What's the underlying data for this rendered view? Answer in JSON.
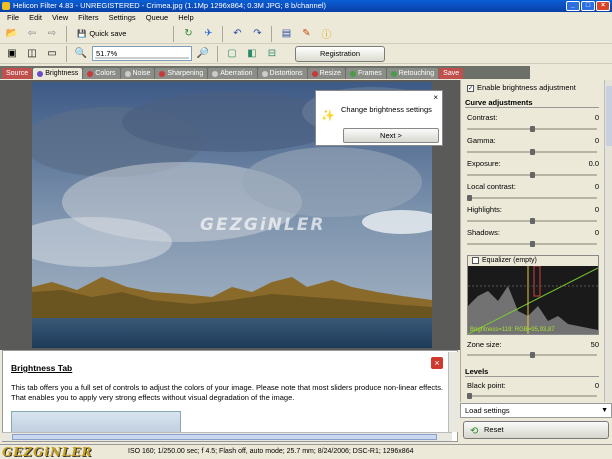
{
  "window": {
    "title": "Helicon Filter 4.83 - UNREGISTERED - Crimea.jpg (1.1Mp 1296x864; 0.3M JPG; 8 b/channel)"
  },
  "menu": [
    "File",
    "Edit",
    "View",
    "Filters",
    "Settings",
    "Queue",
    "Help"
  ],
  "toolbar": {
    "quick_save": "Quick save",
    "zoom": "51.7%",
    "registration": "Registration"
  },
  "tabs": [
    "Source",
    "Brightness",
    "Colors",
    "Noise",
    "Sharpening",
    "Aberration",
    "Distortions",
    "Resize",
    "Frames",
    "Retouching",
    "Save"
  ],
  "popup": {
    "text": "Change brightness settings",
    "next": "Next >"
  },
  "watermark": "GEZGiNLER",
  "help": {
    "title": "Brightness Tab",
    "body": "This tab offers you a full set of controls to adjust the colors of your image.  Please note that most sliders produce non-linear effects.  That enables you to apply very strong effects without visual degradation of the image."
  },
  "panel": {
    "enable_label": "Enable brightness adjustment",
    "curve_title": "Curve adjustments",
    "sliders": [
      {
        "label": "Contrast:",
        "value": "0",
        "pos": 0.5
      },
      {
        "label": "Gamma:",
        "value": "0",
        "pos": 0.5
      },
      {
        "label": "Exposure:",
        "value": "0.0",
        "pos": 0.5
      },
      {
        "label": "Local contrast:",
        "value": "0",
        "pos": 0.0
      },
      {
        "label": "Highlights:",
        "value": "0",
        "pos": 0.5
      },
      {
        "label": "Shadows:",
        "value": "0",
        "pos": 0.5
      }
    ],
    "equalizer_title": "Equalizer (empty)",
    "equalizer_info": "Brightness=119: RGB=95,93,87",
    "zone_label": "Zone size:",
    "zone_value": "50",
    "levels_title": "Levels",
    "black_point_label": "Black point:",
    "black_point_value": "0",
    "load_settings": "Load settings",
    "reset": "Reset"
  },
  "status": {
    "logo": "GEZGiNLER",
    "text": "ISO 160; 1/250.00 sec; f 4.5; Flash off, auto mode; 25.7 mm; 8/24/2006; DSC-R1; 1296x864"
  }
}
